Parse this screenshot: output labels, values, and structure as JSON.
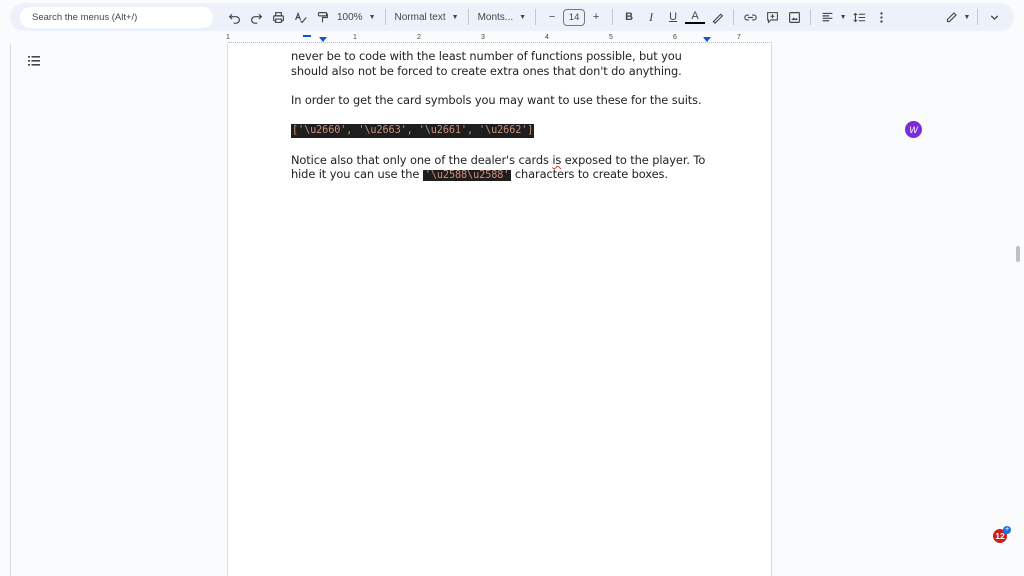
{
  "toolbar": {
    "search_placeholder": "Search the menus (Alt+/)",
    "zoom": "100%",
    "style": "Normal text",
    "font": "Monts...",
    "font_size": "14",
    "bold": "B",
    "italic": "I",
    "underline": "U",
    "text_color": "A",
    "minus": "−",
    "plus": "+"
  },
  "ruler": [
    "1",
    "1",
    "2",
    "3",
    "4",
    "5",
    "6",
    "7"
  ],
  "document": {
    "para1": "never be to code with the least number of functions possible, but you should also not be forced to create extra ones that don't do anything.",
    "para2": "In order to get the card symbols you may want to use these for the suits.",
    "code_block": "['\\u2660', '\\u2663', '\\u2661', '\\u2662']",
    "para3_a": "Notice also that only one of the dealer's cards ",
    "para3_squiggle": "is",
    "para3_b": " exposed to the player.  To hide it you can use the ",
    "para3_code": "'\\u2588\\u2588'",
    "para3_c": " characters to create boxes."
  },
  "addon_label": "W",
  "notification_count": "12",
  "colors": {
    "accent": "#0b57d0",
    "code_bg": "#1e1e1e",
    "code_text": "#ce9178",
    "addon": "#7b2bd8",
    "badge": "#c5221f"
  }
}
